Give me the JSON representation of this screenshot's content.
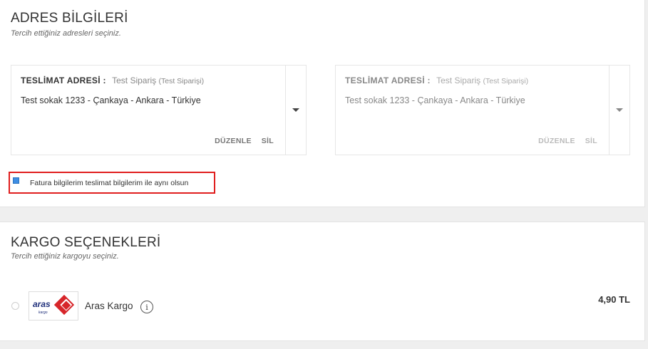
{
  "address_section": {
    "title": "ADRES BİLGİLERİ",
    "subtitle": "Tercih ettiğiniz adresleri seçiniz.",
    "delivery_card": {
      "label": "TESLİMAT ADRESİ :",
      "name": "Test Sipariş",
      "alias": "(Test Siparişi)",
      "address": "Test sokak 1233 - Çankaya - Ankara - Türkiye",
      "edit_label": "DÜZENLE",
      "delete_label": "SİL"
    },
    "billing_card": {
      "label": "TESLİMAT ADRESİ :",
      "name": "Test Sipariş",
      "alias": "(Test Siparişi)",
      "address": "Test sokak 1233 - Çankaya - Ankara - Türkiye",
      "edit_label": "DÜZENLE",
      "delete_label": "SİL"
    },
    "same_billing": {
      "label": "Fatura bilgilerim teslimat bilgilerim ile aynı olsun",
      "checked": true
    }
  },
  "cargo_section": {
    "title": "KARGO SEÇENEKLERİ",
    "subtitle": "Tercih ettiğiniz kargoyu seçiniz.",
    "options": [
      {
        "name": "Aras Kargo",
        "logo_text": "aras",
        "logo_tagline": "kargo",
        "price": "4,90 TL",
        "selected": false
      }
    ]
  },
  "colors": {
    "accent_red": "#e01e1e",
    "checkbox_blue": "#3f8ee3",
    "aras_navy": "#1f2f7a",
    "aras_red": "#d7262a"
  },
  "icons": {
    "dropdown": "caret-down-icon",
    "info": "info-icon"
  }
}
